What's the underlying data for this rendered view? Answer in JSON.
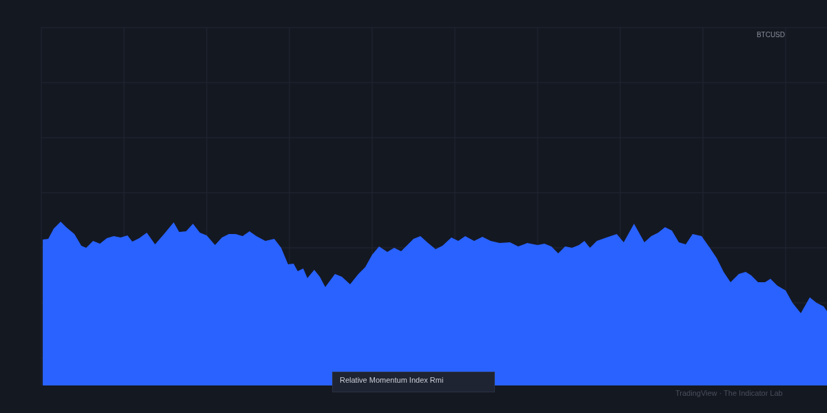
{
  "chart": {
    "symbol": "BTCUSD",
    "legend": "Relative Momentum Index Rmi"
  },
  "credit": "TradingView · The Indicator Lab"
}
